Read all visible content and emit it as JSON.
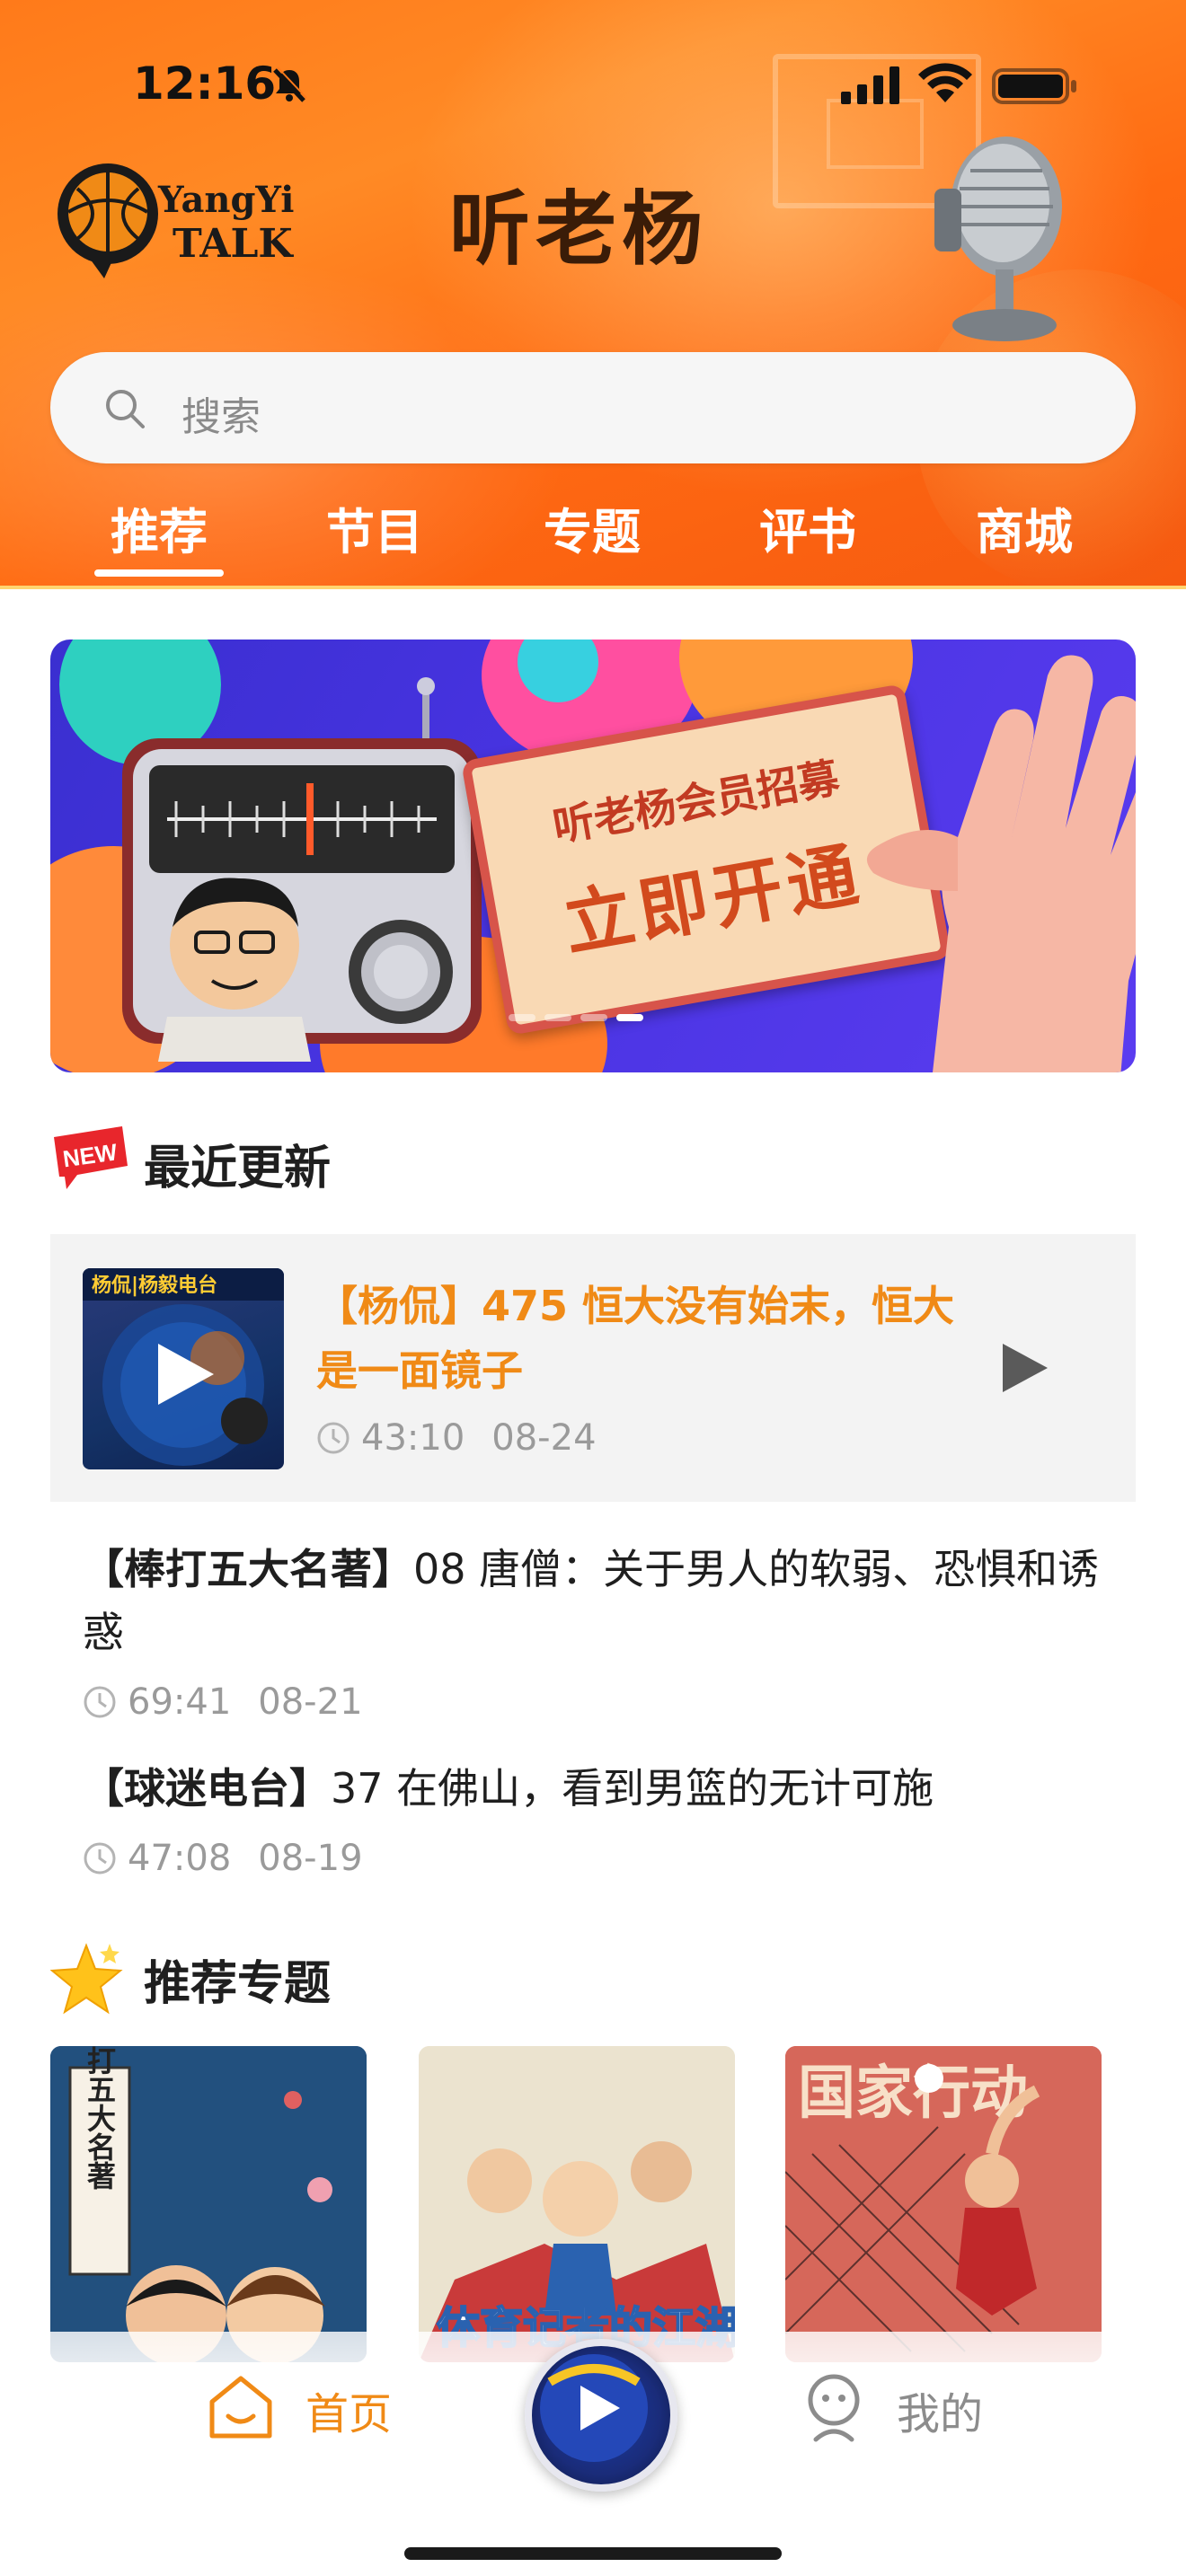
{
  "status_bar": {
    "time": "12:16"
  },
  "header": {
    "logo_text_1": "YangYi",
    "logo_text_2": "TALK",
    "app_title": "听老杨",
    "search_placeholder": "搜索",
    "tabs": [
      {
        "label": "推荐",
        "active": true
      },
      {
        "label": "节目",
        "active": false
      },
      {
        "label": "专题",
        "active": false
      },
      {
        "label": "评书",
        "active": false
      },
      {
        "label": "商城",
        "active": false
      }
    ]
  },
  "banner": {
    "line1": "听老杨会员招募",
    "line2": "立即开通",
    "slide_count": 4,
    "active_slide": 4
  },
  "recent": {
    "title": "最近更新",
    "badge": "NEW",
    "featured": {
      "thumb_caption": "杨侃|杨毅电台",
      "title": "【杨侃】475 恒大没有始末，恒大是一面镜子",
      "duration": "43:10",
      "date": "08-24"
    },
    "episodes": [
      {
        "series": "【棒打五大名著】",
        "title": "08 唐僧：关于男人的软弱、恐惧和诱惑",
        "duration": "69:41",
        "date": "08-21"
      },
      {
        "series": "【球迷电台】",
        "title": "37 在佛山，看到男篮的无计可施",
        "duration": "47:08",
        "date": "08-19"
      }
    ]
  },
  "topics": {
    "title": "推荐专题",
    "items": [
      {
        "name": "棒打五大名著"
      },
      {
        "name": "体育记者的江湖"
      },
      {
        "name": "国家行动"
      }
    ]
  },
  "bottom_nav": {
    "home_label": "首页",
    "me_label": "我的"
  },
  "colors": {
    "accent": "#f08a16",
    "header_orange": "#ff7a1a",
    "banner_blue": "#4733e0"
  }
}
